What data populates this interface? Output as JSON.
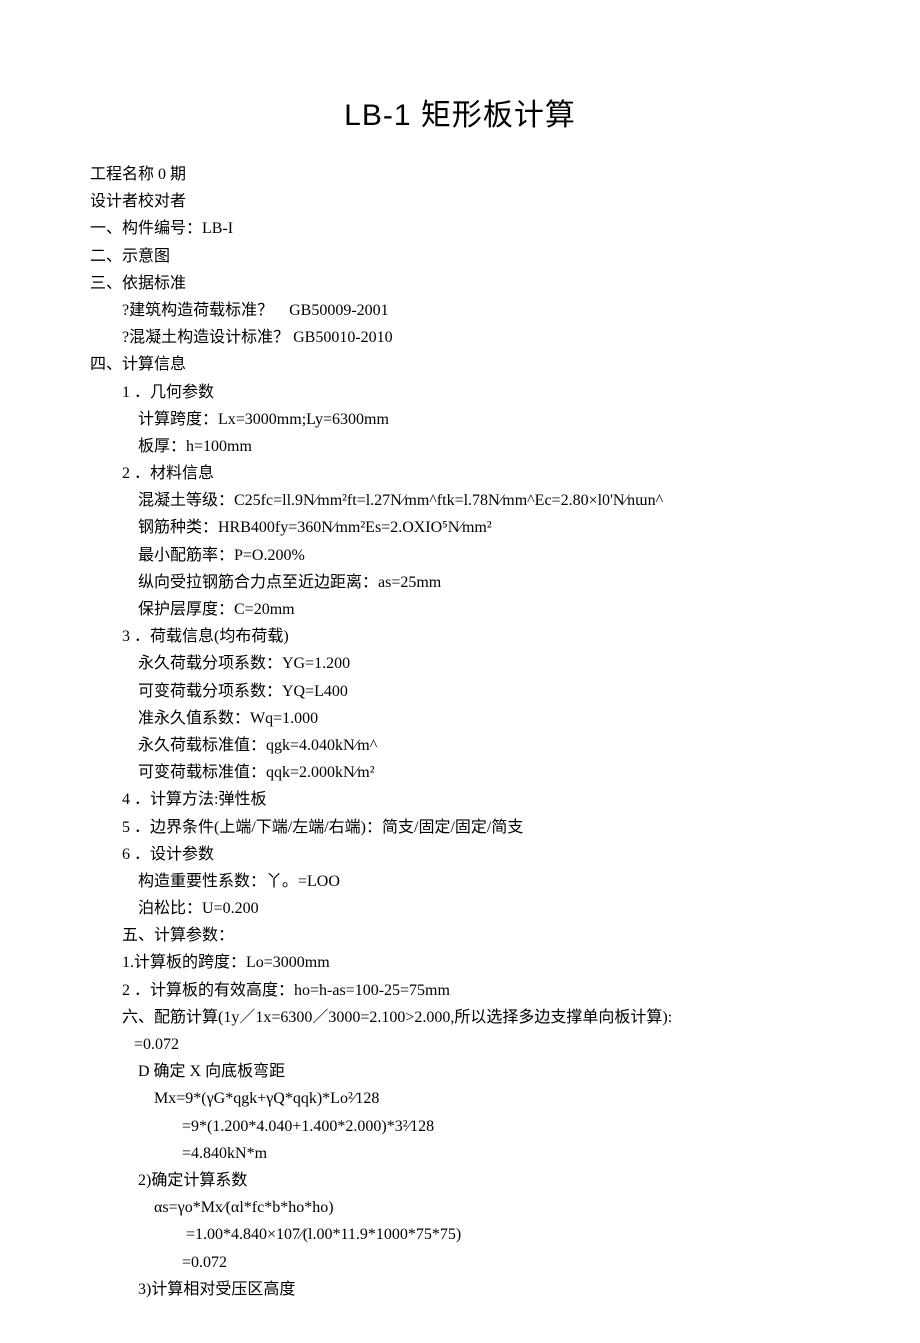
{
  "title": "LB-1 矩形板计算",
  "header": {
    "project": "工程名称 0 期",
    "designer": "设计者校对者"
  },
  "s1": {
    "heading": "一、构件编号：LB-I"
  },
  "s2": {
    "heading": "二、示意图"
  },
  "s3": {
    "heading": "三、依据标准",
    "std1": "?建筑构造荷载标准？    GB50009-2001",
    "std2": "?混凝土构造设计标准？ GB50010-2010"
  },
  "s4": {
    "heading": "四、计算信息",
    "p1": {
      "h": "1 ．几何参数",
      "a": "计算跨度：Lx=3000mm;Ly=6300mm",
      "b": "板厚：h=100mm"
    },
    "p2": {
      "h": "2 ．材料信息",
      "a": "混凝土等级：C25fc=ll.9N⁄mm²ft=l.27N⁄mm^ftk=l.78N⁄mm^Ec=2.80×l0'N⁄nɯn^",
      "b": "钢筋种类：HRB400fy=360N⁄mm²Es=2.OXIO⁵N⁄mm²",
      "c": "最小配筋率：P=O.200%",
      "d": "纵向受拉钢筋合力点至近边距离：as=25mm",
      "e": "保护层厚度：C=20mm"
    },
    "p3": {
      "h": "3 ．荷载信息(均布荷载)",
      "a": "永久荷载分项系数：YG=1.200",
      "b": "可变荷载分项系数：YQ=L400",
      "c": "准永久值系数：Wq=1.000",
      "d": "永久荷载标准值：qgk=4.040kN⁄m^",
      "e": "可变荷载标准值：qqk=2.000kN⁄m²"
    },
    "p4": {
      "h": "4 ．计算方法:弹性板"
    },
    "p5": {
      "h": "5 ．边界条件(上端/下端/左端/右端)：简支/固定/固定/简支"
    },
    "p6": {
      "h": "6 ．设计参数",
      "a": "构造重要性系数：丫。=LOO",
      "b": "泊松比：U=0.200"
    }
  },
  "s5": {
    "heading": "五、计算参数：",
    "a": "1.计算板的跨度：Lo=3000mm",
    "b": "2 ．计算板的有效高度：ho=h-as=100-25=75mm"
  },
  "s6": {
    "heading": "六、配筋计算(1y／1x=6300／3000=2.100>2.000,所以选择多边支撑单向板计算):",
    "p1": {
      "h": "   =0.072",
      "a": "D 确定 X 向底板弯距",
      "b": "Mx=9*(γG*qgk+γQ*qqk)*Lo²⁄128",
      "c": "   =9*(1.200*4.040+1.400*2.000)*3²⁄128",
      "d": "   =4.840kN*m",
      "e": "2)确定计算系数",
      "f": "αs=γo*Mx⁄(αl*fc*b*ho*ho)",
      "g": "    =1.00*4.840×107⁄(l.00*11.9*1000*75*75)",
      "i": "3)计算相对受压区高度"
    }
  }
}
